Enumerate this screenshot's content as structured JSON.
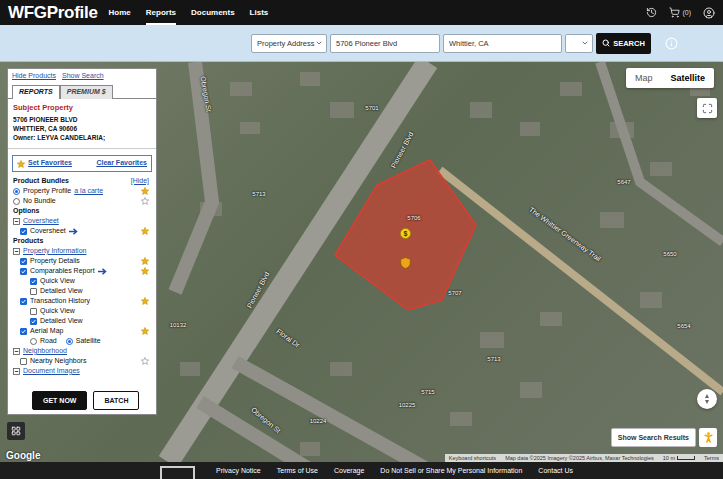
{
  "header": {
    "logo": "WFGProfile",
    "nav": [
      {
        "label": "Home",
        "selected": false
      },
      {
        "label": "Reports",
        "selected": true
      },
      {
        "label": "Documents",
        "selected": false
      },
      {
        "label": "Lists",
        "selected": false
      }
    ],
    "cart_count": "(0)"
  },
  "search": {
    "type": "Property Address",
    "address": "5706 Pioneer Blvd",
    "city": "Whittier, CA",
    "unit": "",
    "button": "SEARCH"
  },
  "panel": {
    "links": [
      "Hide Products",
      "Show Search"
    ],
    "tabs": [
      {
        "label": "REPORTS",
        "selected": true
      },
      {
        "label": "PREMIUM $",
        "selected": false
      }
    ],
    "subject": {
      "title": "Subject Property",
      "lines": [
        "5706 PIONEER BLVD",
        "WHITTIER, CA 90606",
        "Owner: LEYVA CANDELARIA;"
      ]
    },
    "favorites": [
      "Set Favorites",
      "Clear Favorites"
    ],
    "bundles": {
      "title": "Product Bundles",
      "hide": "[Hide]",
      "items": [
        {
          "label": "Property Profile",
          "link": "a la carte",
          "selected": true,
          "favorite": true
        },
        {
          "label": "No Bundle",
          "link": "",
          "selected": false,
          "favorite": false
        }
      ]
    },
    "rows": [
      {
        "kind": "heading",
        "label": "Options"
      },
      {
        "kind": "group",
        "label": "Coversheet",
        "expanded": true
      },
      {
        "kind": "check",
        "label": "Coversheet",
        "checked": true,
        "arrow": true,
        "favorite": true
      },
      {
        "kind": "heading",
        "label": "Products"
      },
      {
        "kind": "group",
        "label": "Property Information",
        "expanded": true
      },
      {
        "kind": "check",
        "label": "Property Details",
        "checked": true,
        "arrow": false,
        "favorite": true
      },
      {
        "kind": "check",
        "label": "Comparables Report",
        "checked": true,
        "arrow": true,
        "favorite": true,
        "children": [
          {
            "label": "Quick View",
            "checked": true
          },
          {
            "label": "Detailed View",
            "checked": false
          }
        ]
      },
      {
        "kind": "check",
        "label": "Transaction History",
        "checked": true,
        "arrow": false,
        "favorite": true,
        "children": [
          {
            "label": "Quick View",
            "checked": false
          },
          {
            "label": "Detailed View",
            "checked": true
          }
        ]
      },
      {
        "kind": "check",
        "label": "Aerial Map",
        "checked": true,
        "arrow": false,
        "favorite": true,
        "options": [
          {
            "label": "Road",
            "selected": false
          },
          {
            "label": "Satellite",
            "selected": true
          }
        ]
      },
      {
        "kind": "group",
        "label": "Neighborhood",
        "expanded": true
      },
      {
        "kind": "check",
        "label": "Nearby Neighbors",
        "checked": false,
        "arrow": false,
        "favorite": false
      },
      {
        "kind": "group",
        "label": "Document Images",
        "expanded": true
      }
    ],
    "buttons": [
      "GET NOW",
      "BATCH"
    ]
  },
  "map": {
    "types": [
      {
        "label": "Map",
        "selected": false
      },
      {
        "label": "Satellite",
        "selected": true
      }
    ],
    "streets": [
      "Pioneer Blvd",
      "Pioneer Blvd",
      "Obregon St",
      "Obregon St",
      "Floral Dr",
      "The Whittier Greenway Trail"
    ],
    "parcels": [
      "5706",
      "5701",
      "5713",
      "5707",
      "5713",
      "5715",
      "5647",
      "5650",
      "5654",
      "10225",
      "10224",
      "10132"
    ],
    "pin": "$",
    "show_results": "Show Search Results",
    "logo": "Google",
    "attribution": [
      "Keyboard shortcuts",
      "Map data ©2025 Imagery ©2025 Airbus, Maxar Technologies",
      "10 m",
      "Terms"
    ]
  },
  "footer": {
    "links": [
      "Privacy Notice",
      "Terms of Use",
      "Coverage",
      "Do Not Sell or Share My Personal Information",
      "Contact Us"
    ]
  }
}
